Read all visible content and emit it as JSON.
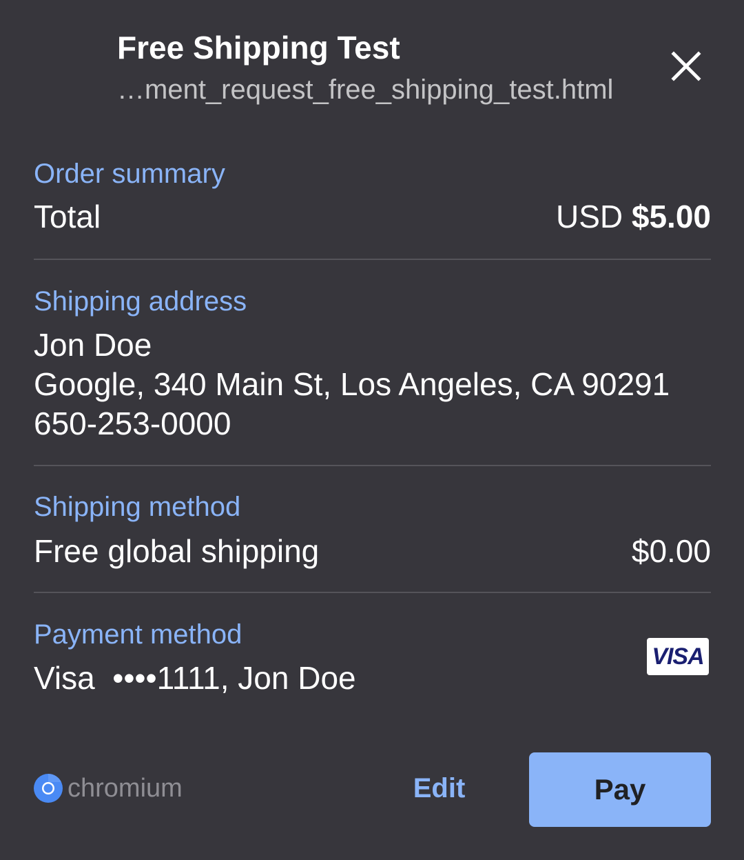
{
  "header": {
    "title": "Free Shipping Test",
    "origin": "…ment_request_free_shipping_test.html"
  },
  "order_summary": {
    "label": "Order summary",
    "total_label": "Total",
    "currency": "USD",
    "total_amount": "$5.00"
  },
  "shipping_address": {
    "label": "Shipping address",
    "name": "Jon Doe",
    "address": "Google, 340 Main St, Los Angeles, CA 90291",
    "phone": "650-253-0000"
  },
  "shipping_method": {
    "label": "Shipping method",
    "option": "Free global shipping",
    "price": "$0.00"
  },
  "payment_method": {
    "label": "Payment method",
    "summary": "Visa  ••••1111, Jon Doe",
    "card_brand": "VISA"
  },
  "footer": {
    "brand": "chromium",
    "edit_label": "Edit",
    "pay_label": "Pay"
  },
  "colors": {
    "background": "#37363c",
    "accent": "#8ab4f8",
    "divider": "#55545a"
  },
  "icons": {
    "close": "close-icon",
    "brand": "chromium-logo-icon"
  }
}
